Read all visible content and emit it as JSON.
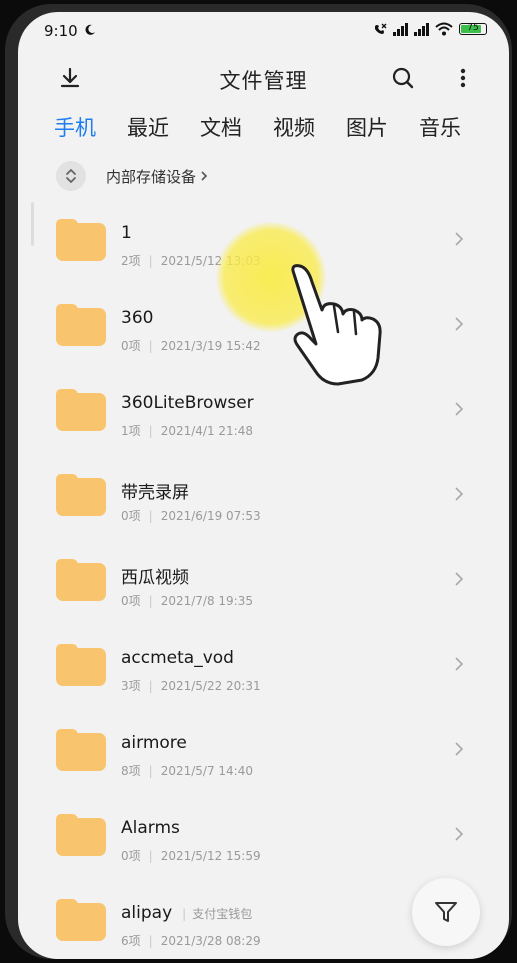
{
  "status": {
    "time": "9:10",
    "battery": "75"
  },
  "header": {
    "title": "文件管理"
  },
  "tabs": [
    {
      "label": "手机",
      "active": true
    },
    {
      "label": "最近"
    },
    {
      "label": "文档"
    },
    {
      "label": "视频"
    },
    {
      "label": "图片"
    },
    {
      "label": "音乐"
    }
  ],
  "breadcrumb": {
    "label": "内部存储设备"
  },
  "files": [
    {
      "name": "1",
      "count": "2项",
      "date": "2021/5/12 13:03"
    },
    {
      "name": "360",
      "count": "0项",
      "date": "2021/3/19 15:42"
    },
    {
      "name": "360LiteBrowser",
      "count": "1项",
      "date": "2021/4/1 21:48"
    },
    {
      "name": "带壳录屏",
      "count": "0项",
      "date": "2021/6/19 07:53"
    },
    {
      "name": "西瓜视频",
      "count": "0项",
      "date": "2021/7/8 19:35"
    },
    {
      "name": "accmeta_vod",
      "count": "3项",
      "date": "2021/5/22 20:31"
    },
    {
      "name": "airmore",
      "count": "8项",
      "date": "2021/5/7 14:40"
    },
    {
      "name": "Alarms",
      "count": "0项",
      "date": "2021/5/12 15:59"
    },
    {
      "name": "alipay",
      "tag": "支付宝钱包",
      "count": "6项",
      "date": "2021/3/28 08:29"
    }
  ],
  "colors": {
    "accent": "#1e7df0",
    "folder": "#f8c46d",
    "touch": "#faeb46"
  }
}
